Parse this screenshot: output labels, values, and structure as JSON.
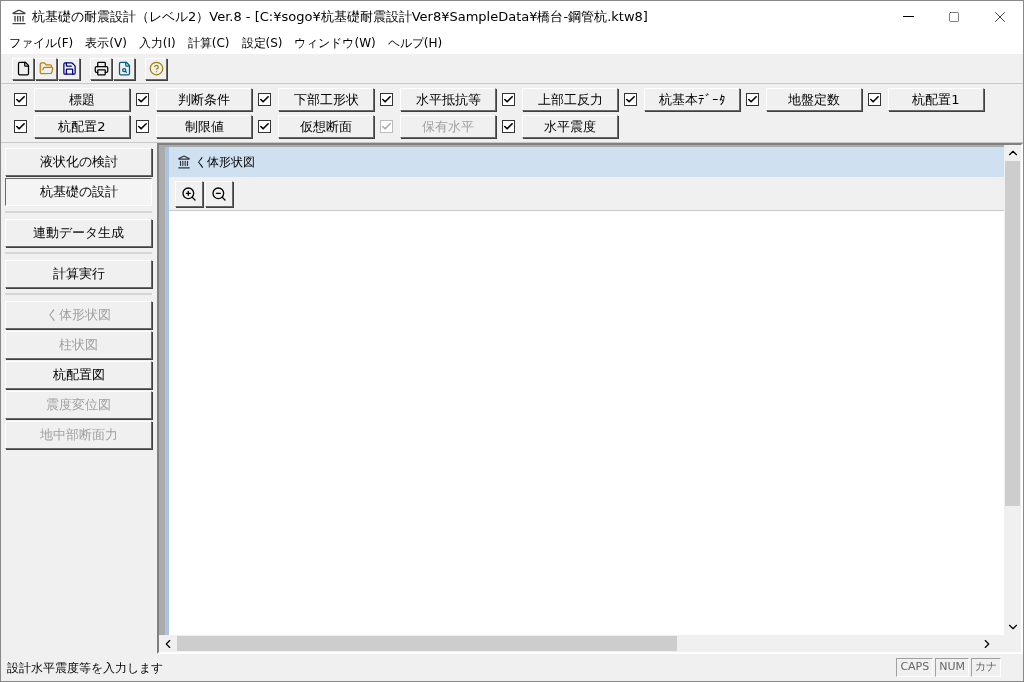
{
  "window": {
    "title": "杭基礎の耐震設計（レベル2）Ver.8 - [C:¥sogo¥杭基礎耐震設計Ver8¥SampleData¥橋台-鋼管杭.ktw8]"
  },
  "menu": [
    "ファイル(F)",
    "表示(V)",
    "入力(I)",
    "計算(C)",
    "設定(S)",
    "ウィンドウ(W)",
    "ヘルプ(H)"
  ],
  "input_rows": [
    [
      {
        "label": "標題",
        "checked": true,
        "disabled": false
      },
      {
        "label": "判断条件",
        "checked": true,
        "disabled": false
      },
      {
        "label": "下部工形状",
        "checked": true,
        "disabled": false
      },
      {
        "label": "水平抵抗等",
        "checked": true,
        "disabled": false
      },
      {
        "label": "上部工反力",
        "checked": true,
        "disabled": false
      },
      {
        "label": "杭基本ﾃﾞｰﾀ",
        "checked": true,
        "disabled": false
      },
      {
        "label": "地盤定数",
        "checked": true,
        "disabled": false
      },
      {
        "label": "杭配置1",
        "checked": true,
        "disabled": false
      }
    ],
    [
      {
        "label": "杭配置2",
        "checked": true,
        "disabled": false
      },
      {
        "label": "制限値",
        "checked": true,
        "disabled": false
      },
      {
        "label": "仮想断面",
        "checked": true,
        "disabled": false
      },
      {
        "label": "保有水平",
        "checked": true,
        "disabled": true
      },
      {
        "label": "水平震度",
        "checked": true,
        "disabled": false
      }
    ]
  ],
  "sidebar": {
    "groups": [
      [
        {
          "label": "液状化の検討",
          "selected": false,
          "disabled": false
        },
        {
          "label": "杭基礎の設計",
          "selected": true,
          "disabled": false
        }
      ],
      [
        {
          "label": "連動データ生成",
          "selected": false,
          "disabled": false
        }
      ],
      [
        {
          "label": "計算実行",
          "selected": false,
          "disabled": false
        }
      ],
      [
        {
          "label": "く体形状図",
          "selected": false,
          "disabled": true
        },
        {
          "label": "柱状図",
          "selected": false,
          "disabled": true
        },
        {
          "label": "杭配置図",
          "selected": false,
          "disabled": false
        },
        {
          "label": "震度変位図",
          "selected": false,
          "disabled": true
        },
        {
          "label": "地中部断面力",
          "selected": false,
          "disabled": true
        }
      ]
    ]
  },
  "child_window": {
    "title": "く体形状図"
  },
  "status_bar": {
    "message": "設計水平震度等を入力します",
    "indicators": [
      "CAPS",
      "NUM",
      "カナ"
    ]
  }
}
